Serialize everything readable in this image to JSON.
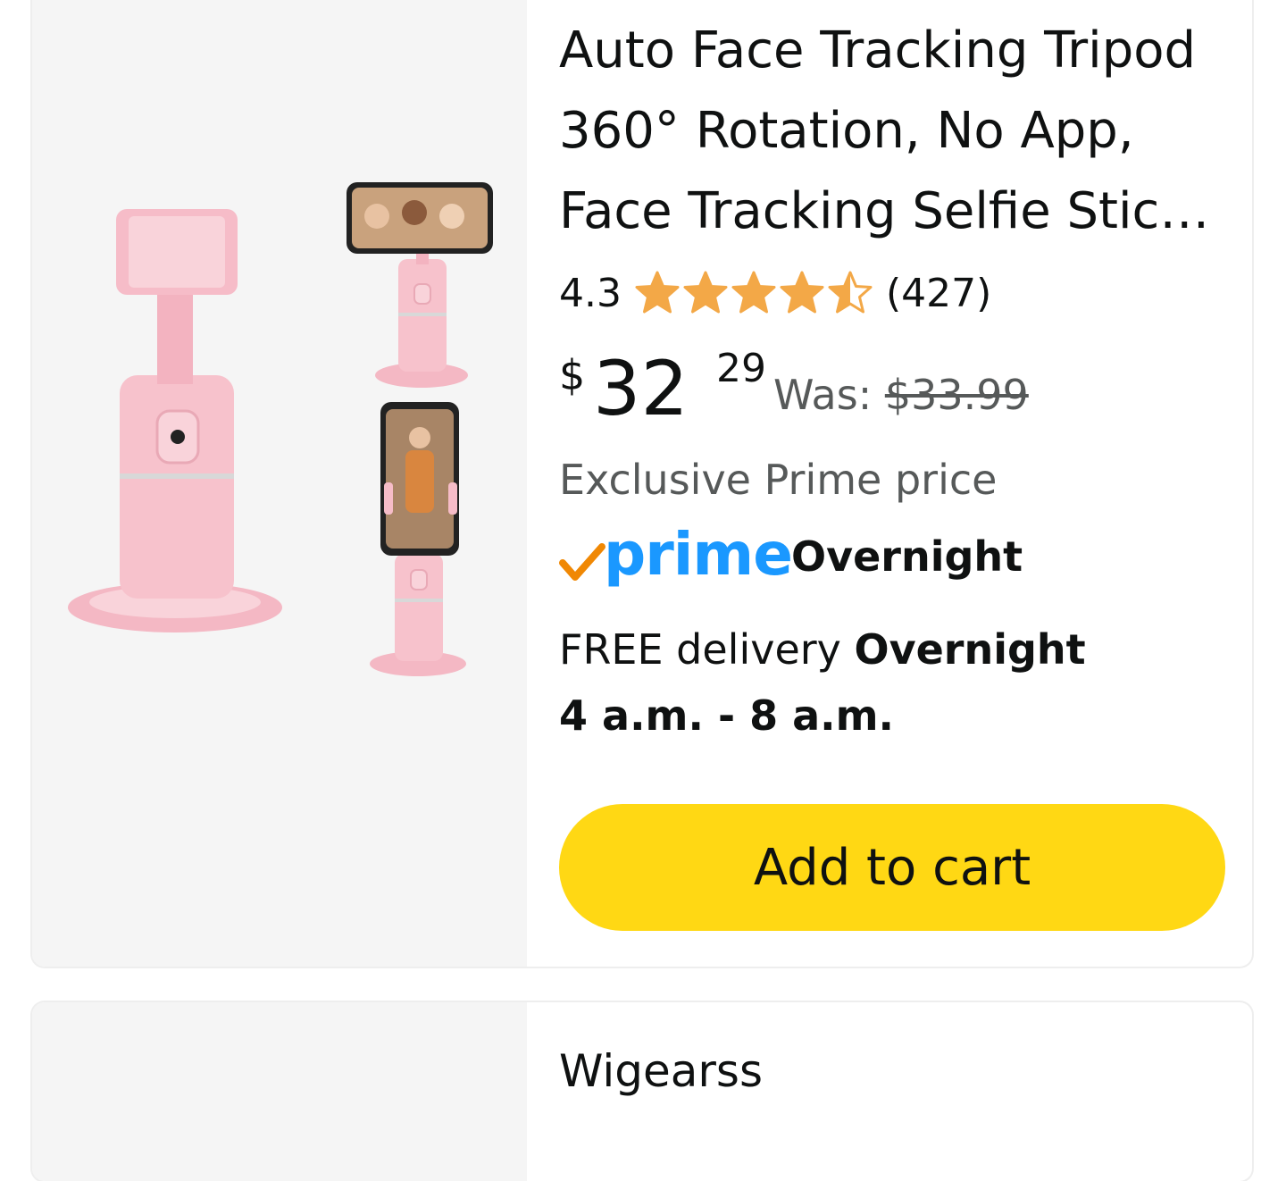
{
  "product": {
    "title_lines": [
      "Auto Face Tracking Tripod",
      "360° Rotation, No App,",
      "Face Tracking Selfie Stic…"
    ],
    "rating": "4.3",
    "rating_value": 4.3,
    "stars_max": 5,
    "review_count": "(427)",
    "price_symbol": "$",
    "price_whole": "32",
    "price_fraction": "29",
    "was_label": "Was:",
    "was_price": "$33.99",
    "exclusive_label": "Exclusive Prime price",
    "prime_word": "prime",
    "prime_label": "Overnight",
    "delivery_prefix": "FREE delivery",
    "delivery_bold": "Overnight",
    "delivery_window": "4 a.m. - 8 a.m.",
    "cart_label": "Add to cart",
    "product_color": "#f7c6cf"
  },
  "next_product": {
    "title_partial": "Wigearss"
  },
  "colors": {
    "star": "#f3a847",
    "button": "#ffd814",
    "prime_blue": "#1a98ff",
    "prime_check": "#f08804"
  }
}
